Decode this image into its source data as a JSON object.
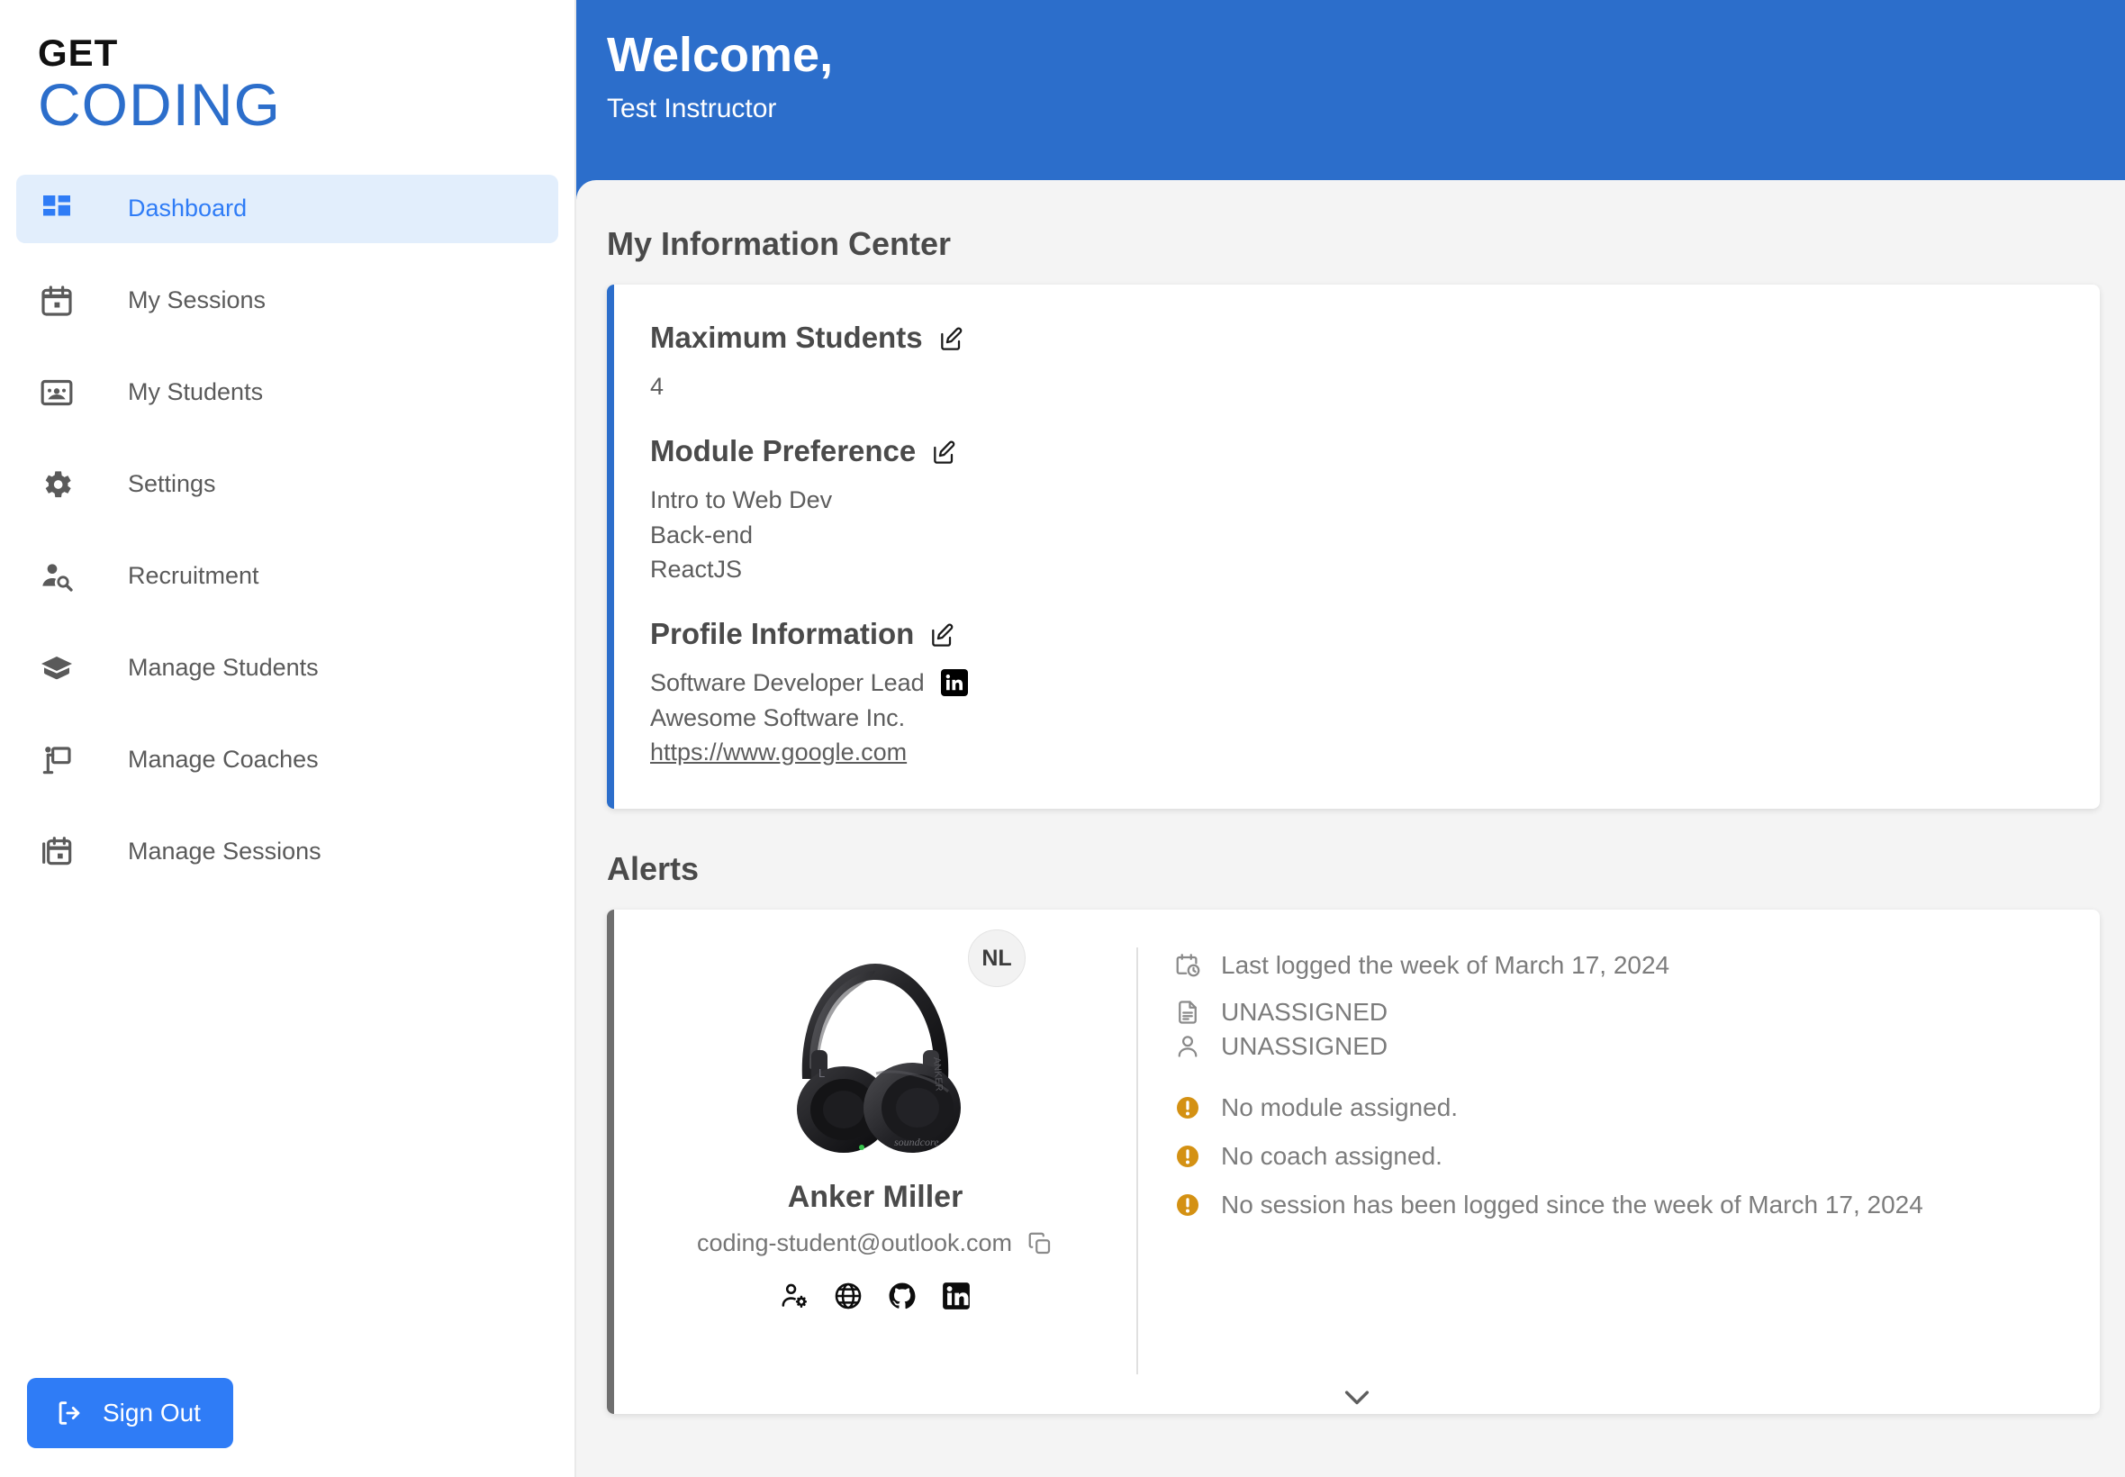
{
  "brand": {
    "line1": "GET",
    "line2": "CODING",
    "accent": "#2c6ecb"
  },
  "sidebar": {
    "items": [
      {
        "label": "Dashboard",
        "icon": "dashboard-icon",
        "active": true
      },
      {
        "label": "My Sessions",
        "icon": "calendar-icon",
        "active": false
      },
      {
        "label": "My Students",
        "icon": "students-icon",
        "active": false
      },
      {
        "label": "Settings",
        "icon": "gear-icon",
        "active": false
      },
      {
        "label": "Recruitment",
        "icon": "person-search-icon",
        "active": false
      },
      {
        "label": "Manage Students",
        "icon": "graduation-cap-icon",
        "active": false
      },
      {
        "label": "Manage Coaches",
        "icon": "presenter-icon",
        "active": false
      },
      {
        "label": "Manage Sessions",
        "icon": "calendar-stack-icon",
        "active": false
      }
    ],
    "sign_out_label": "Sign Out",
    "sign_out_icon": "logout-icon"
  },
  "header": {
    "title": "Welcome,",
    "subtitle": "Test Instructor",
    "background": "#2c6ecb"
  },
  "info_center": {
    "section_title": "My Information Center",
    "accent": "#2c6ecb",
    "fields": [
      {
        "label": "Maximum Students",
        "edit_icon": "edit-pencil-icon",
        "value": "4"
      },
      {
        "label": "Module Preference",
        "edit_icon": "edit-pencil-icon",
        "value": "Intro to Web Dev\nBack-end\nReactJS"
      },
      {
        "label": "Profile Information",
        "edit_icon": "edit-pencil-icon"
      }
    ],
    "profile": {
      "role": "Software Developer Lead",
      "linkedin_icon": "linkedin-icon",
      "company": "Awesome Software Inc.",
      "website": "https://www.google.com"
    }
  },
  "alerts": {
    "section_title": "Alerts",
    "accent": "#6f6f6f",
    "card": {
      "initials": "NL",
      "avatar_icon": "headphones-photo",
      "name": "Anker Miller",
      "email": "coding-student@outlook.com",
      "copy_icon": "copy-icon",
      "social_icons": [
        "person-gear-icon",
        "globe-icon",
        "github-icon",
        "linkedin-icon"
      ],
      "meta": [
        {
          "icon": "calendar-clock-icon",
          "text": "Last logged the week of March 17, 2024"
        },
        {
          "icon": "document-icon",
          "text": "UNASSIGNED"
        },
        {
          "icon": "person-icon",
          "text": "UNASSIGNED"
        }
      ],
      "warnings": [
        {
          "icon": "warning-icon",
          "text": "No module assigned."
        },
        {
          "icon": "warning-icon",
          "text": "No coach assigned."
        },
        {
          "icon": "warning-icon",
          "text": "No session has been logged since the week of March 17, 2024"
        }
      ],
      "warning_color": "#d49113",
      "expand_icon": "chevron-down-icon"
    }
  }
}
